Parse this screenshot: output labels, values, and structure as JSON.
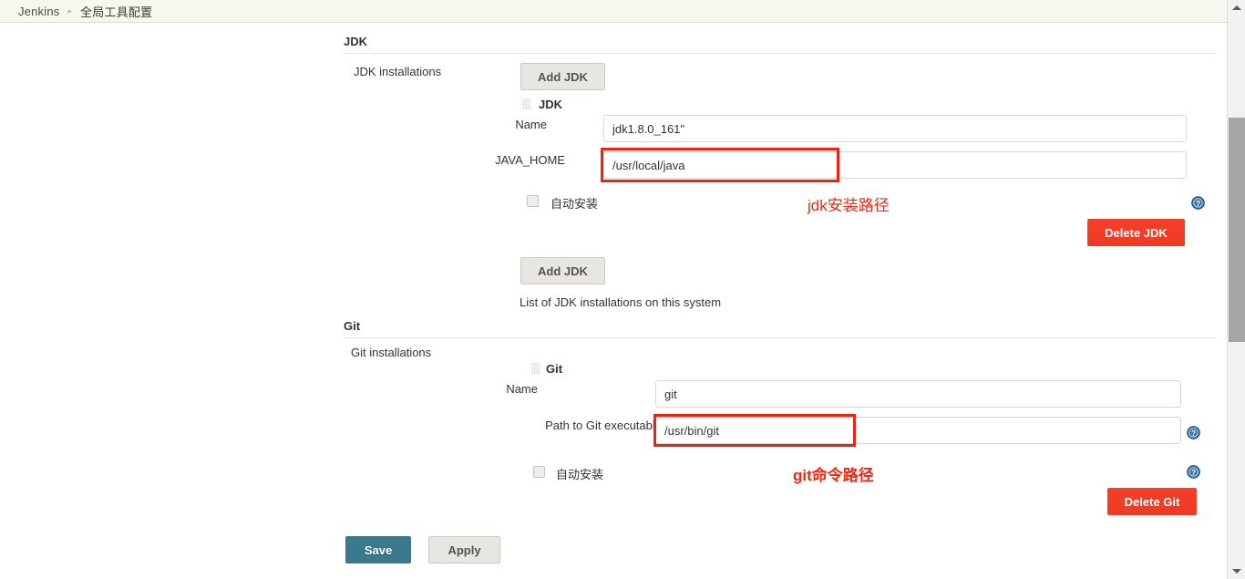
{
  "breadcrumb": {
    "root": "Jenkins",
    "separator": "▸",
    "current": "全局工具配置"
  },
  "jdk_section": {
    "heading": "JDK",
    "installations_label": "JDK installations",
    "add_button_top": "Add JDK",
    "add_button_bottom": "Add JDK",
    "item_title": "JDK",
    "name_label": "Name",
    "name_value": "jdk1.8.0_161\"",
    "java_home_label": "JAVA_HOME",
    "java_home_value": "/usr/local/java",
    "auto_install_label": "自动安装",
    "auto_install_checked": false,
    "delete_button": "Delete JDK",
    "hint": "List of JDK installations on this system",
    "annotation": "jdk安装路径",
    "help_icon": "help-question-icon"
  },
  "git_section": {
    "heading": "Git",
    "installations_label": "Git installations",
    "item_title": "Git",
    "name_label": "Name",
    "name_value": "git",
    "path_label": "Path to Git executable",
    "path_value": "/usr/bin/git",
    "auto_install_label": "自动安装",
    "auto_install_checked": false,
    "delete_button": "Delete Git",
    "annotation": "git命令路径",
    "help_icon": "help-question-icon"
  },
  "footer": {
    "save_label": "Save",
    "apply_label": "Apply"
  },
  "colors": {
    "annotation_red": "#f5240f",
    "delete_red": "#ee3a22",
    "save_teal": "#3a7a8c",
    "breadcrumb_bg": "#f6f8f0",
    "help_blue": "#2a6496"
  }
}
